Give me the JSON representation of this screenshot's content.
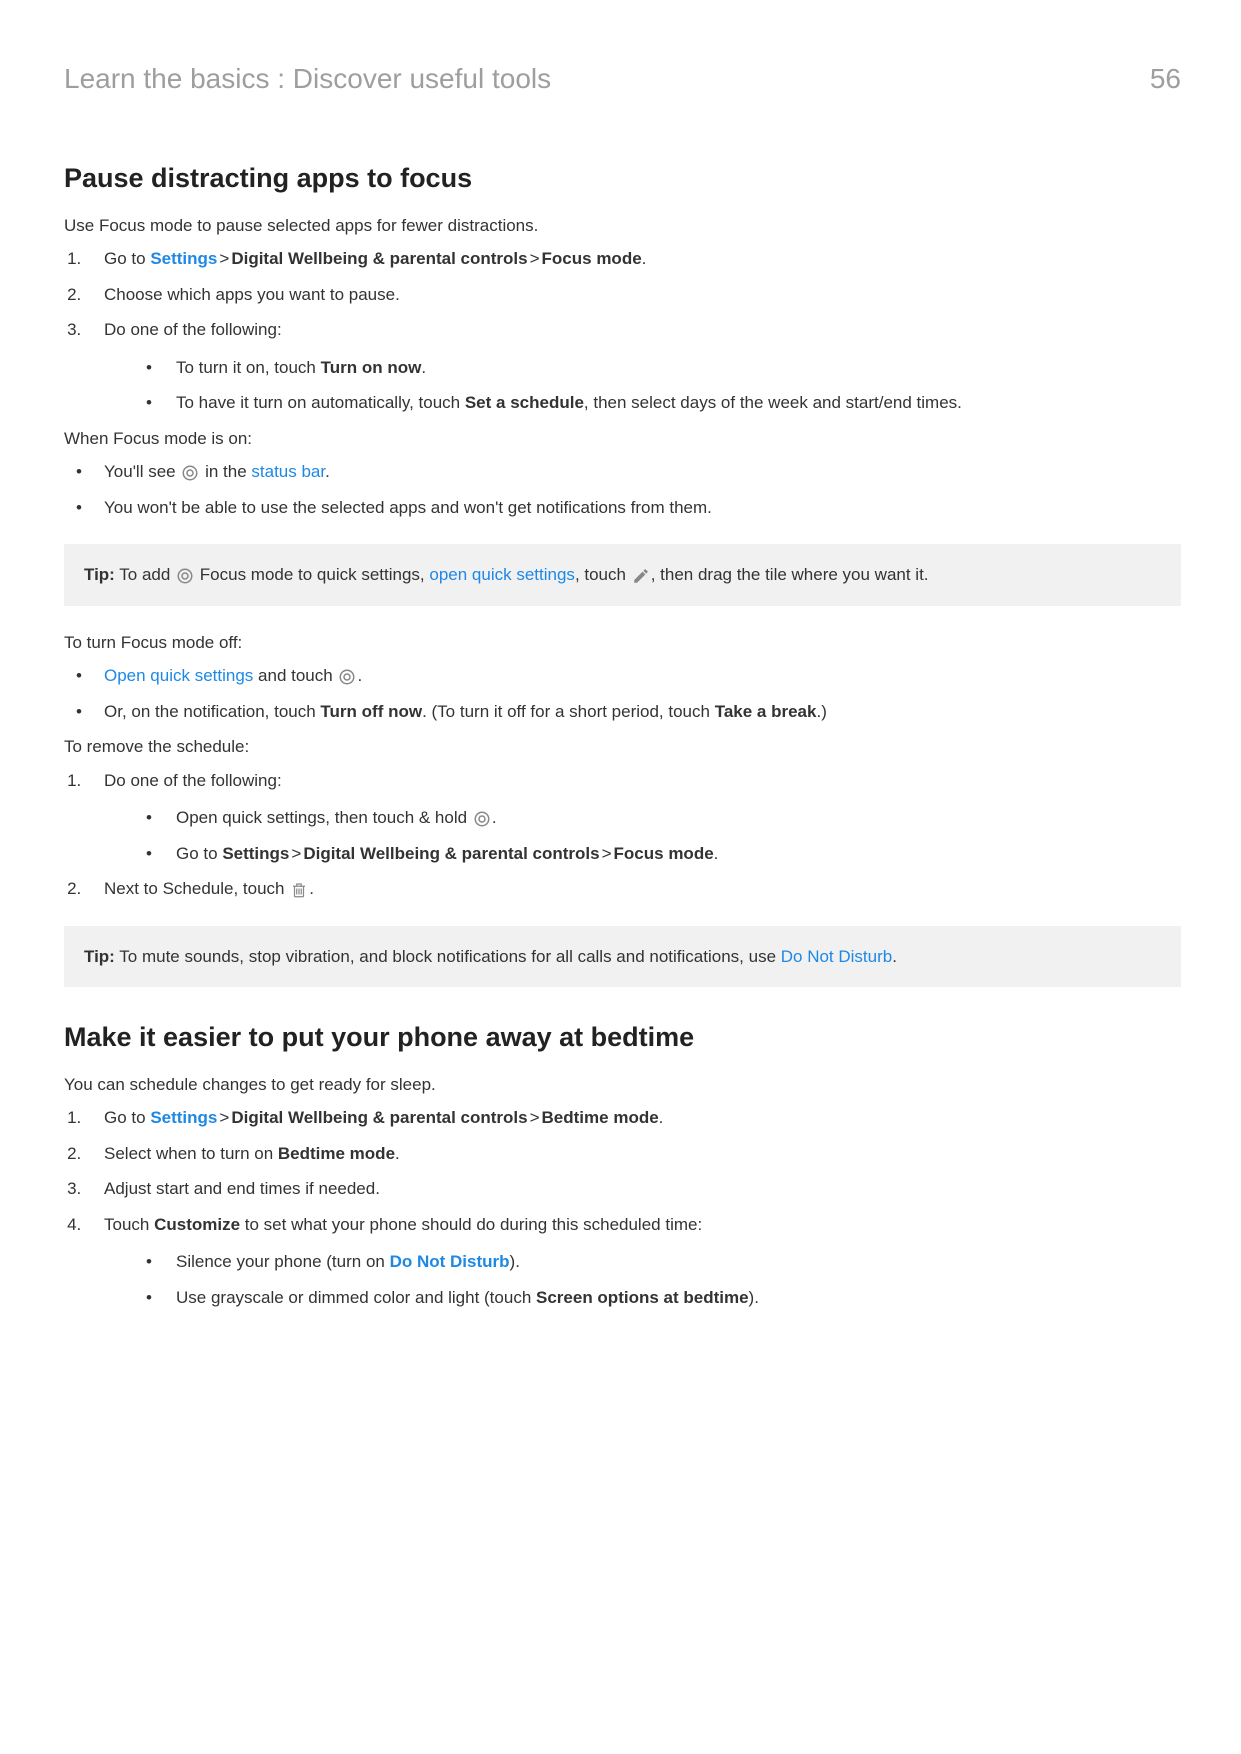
{
  "header": {
    "breadcrumb": "Learn the basics : Discover useful tools",
    "page_number": "56"
  },
  "s1": {
    "title": "Pause distracting apps to focus",
    "intro": "Use Focus mode to pause selected apps for fewer distractions.",
    "step1_prefix": "Go to ",
    "step1_link": "Settings",
    "step1_b1": "Digital Wellbeing & parental controls",
    "step1_b2": "Focus mode",
    "step1_suffix": ".",
    "step2": "Choose which apps you want to pause.",
    "step3": "Do one of the following:",
    "step3_a_prefix": "To turn it on, touch ",
    "step3_a_bold": "Turn on now",
    "step3_a_suffix": ".",
    "step3_b_prefix": "To have it turn on automatically, touch ",
    "step3_b_bold": "Set a schedule",
    "step3_b_suffix": ", then select days of the week and start/end times.",
    "when_on": "When Focus mode is on:",
    "when_a_prefix": "You'll see ",
    "when_a_mid": " in the ",
    "when_a_link": "status bar",
    "when_a_suffix": ".",
    "when_b": "You won't be able to use the selected apps and won't get notifications from them.",
    "tip1_label": "Tip:",
    "tip1_a": " To add ",
    "tip1_b": " Focus mode to quick settings, ",
    "tip1_link": "open quick settings",
    "tip1_c": ", touch ",
    "tip1_d": ", then drag the tile where you want it.",
    "off_intro": "To turn Focus mode off:",
    "off_a_link": "Open quick settings",
    "off_a_mid": " and touch ",
    "off_a_suffix": ".",
    "off_b_prefix": "Or, on the notification, touch ",
    "off_b_bold1": "Turn off now",
    "off_b_mid": ". (To turn it off for a short period, touch ",
    "off_b_bold2": "Take a break",
    "off_b_suffix": ".)",
    "remove_intro": "To remove the schedule:",
    "remove_step1": "Do one of the following:",
    "remove_a_prefix": "Open quick settings, then touch & hold ",
    "remove_a_suffix": ".",
    "remove_b_prefix": "Go to ",
    "remove_b_b1": "Settings",
    "remove_b_b2": "Digital Wellbeing & parental controls",
    "remove_b_b3": "Focus mode",
    "remove_b_suffix": ".",
    "remove_step2_prefix": "Next to Schedule, touch ",
    "remove_step2_suffix": ".",
    "tip2_label": "Tip:",
    "tip2_a": " To mute sounds, stop vibration, and block notifications for all calls and notifications, use ",
    "tip2_link": "Do Not Disturb",
    "tip2_suffix": "."
  },
  "s2": {
    "title": "Make it easier to put your phone away at bedtime",
    "intro": "You can schedule changes to get ready for sleep.",
    "step1_prefix": "Go to ",
    "step1_link": "Settings",
    "step1_b1": "Digital Wellbeing & parental controls",
    "step1_b2": "Bedtime mode",
    "step1_suffix": ".",
    "step2_prefix": "Select when to turn on ",
    "step2_bold": "Bedtime mode",
    "step2_suffix": ".",
    "step3": "Adjust start and end times if needed.",
    "step4_prefix": "Touch ",
    "step4_bold": "Customize",
    "step4_suffix": " to set what your phone should do during this scheduled time:",
    "step4_a_prefix": "Silence your phone (turn on ",
    "step4_a_link": "Do Not Disturb",
    "step4_a_suffix": ").",
    "step4_b_prefix": "Use grayscale or dimmed color and light (touch ",
    "step4_b_bold": "Screen options at bedtime",
    "step4_b_suffix": ")."
  },
  "gt": ">"
}
